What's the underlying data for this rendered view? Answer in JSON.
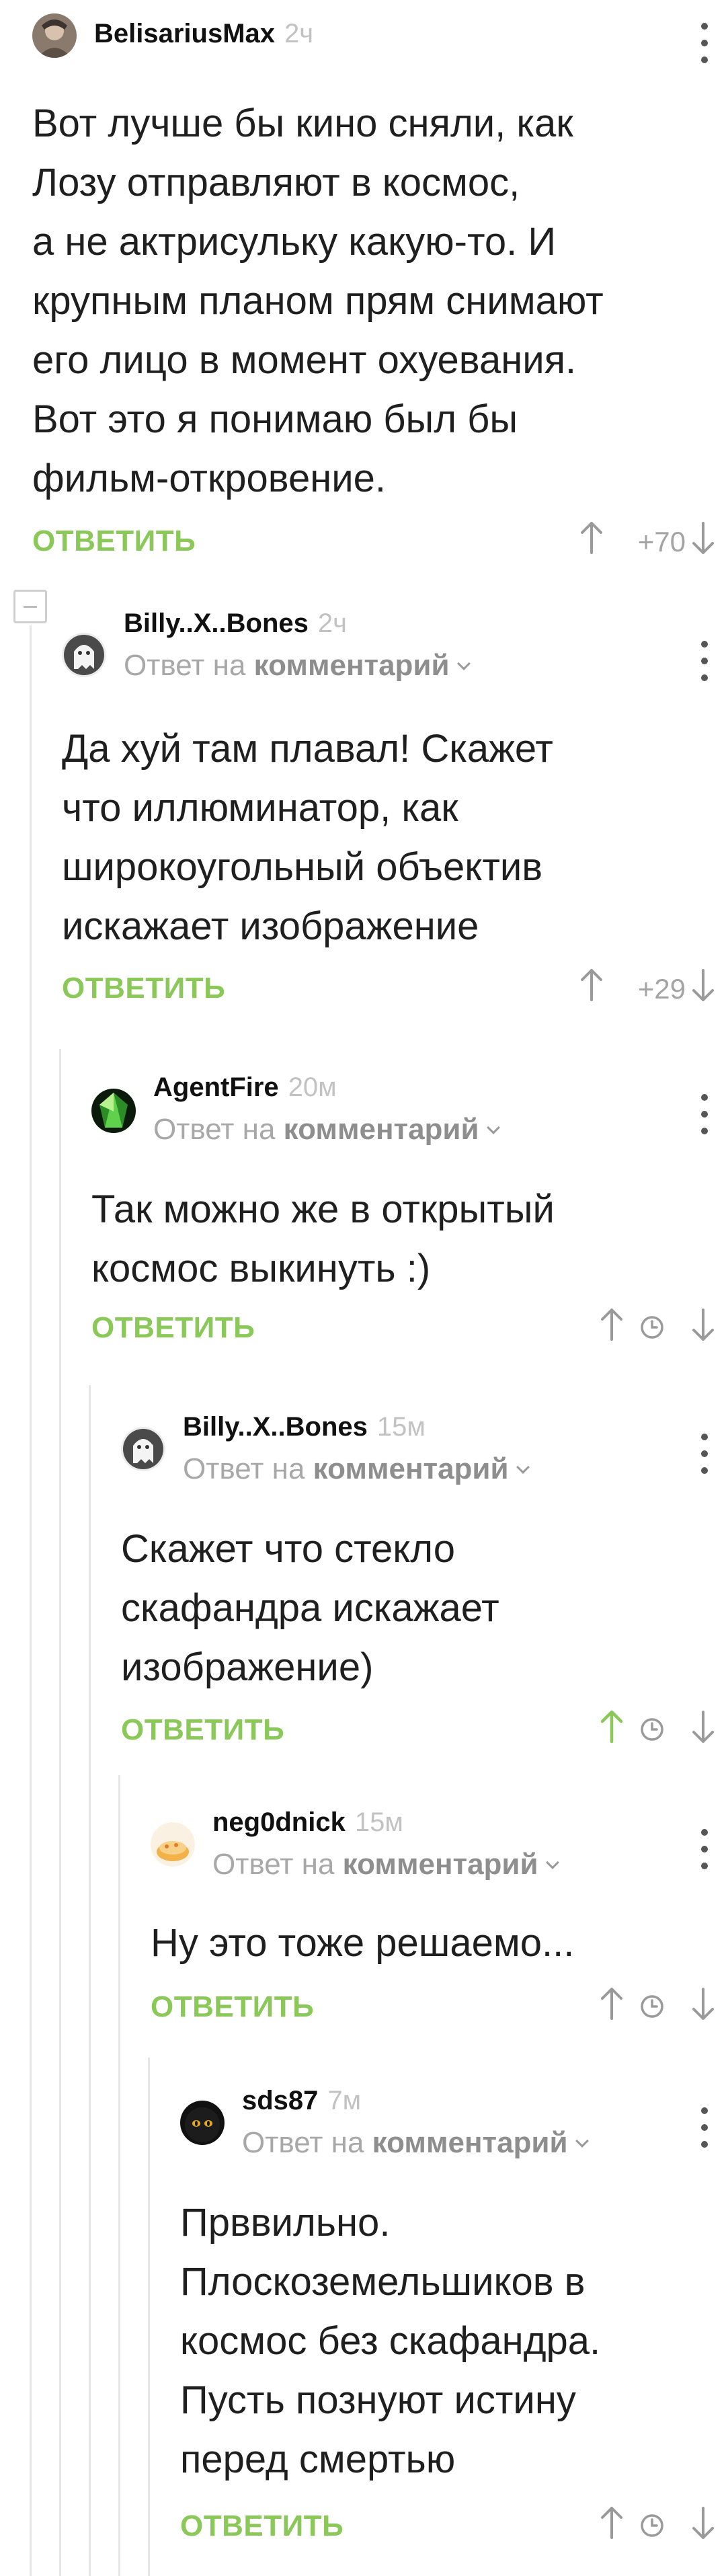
{
  "reply_label": "ОТВЕТИТЬ",
  "reply_to_prefix": "Ответ на",
  "reply_to_link": "комментарий",
  "comments": [
    {
      "author": "BelisariusMax",
      "time": "2ч",
      "text_lines": [
        "Вот лучше бы кино сняли, как",
        "Лозу отправляют в космос,",
        "а не актрисульку какую-то. И",
        "крупным планом прям снимают",
        "его лицо в момент охуевания.",
        "Вот это я понимаю был бы",
        "фильм-откровение."
      ],
      "score": "+70",
      "avatar_icon": "belisarius-avatar"
    },
    {
      "author": "Billy..X..Bones",
      "time": "2ч",
      "text_lines": [
        "Да хуй там плавал! Скажет",
        "что иллюминатор, как",
        "широкоугольный объектив",
        "искажает изображение"
      ],
      "score": "+29",
      "avatar_icon": "ghost-avatar"
    },
    {
      "author": "AgentFire",
      "time": "20м",
      "text_lines": [
        "Так можно же в открытый",
        "космос выкинуть :)"
      ],
      "score_hidden": true,
      "avatar_icon": "green-crystal-avatar"
    },
    {
      "author": "Billy..X..Bones",
      "time": "15м",
      "text_lines": [
        "Скажет что стекло",
        "скафандра искажает",
        "изображение)"
      ],
      "score_hidden": true,
      "upvoted": true,
      "avatar_icon": "ghost-avatar"
    },
    {
      "author": "neg0dnick",
      "time": "15м",
      "text_lines": [
        "Ну это тоже решаемо..."
      ],
      "score_hidden": true,
      "avatar_icon": "food-avatar"
    },
    {
      "author": "sds87",
      "time": "7м",
      "text_lines": [
        "Прввильно.",
        "Плоскоземельшиков в",
        "космос без скафандра.",
        "Пусть познуют истину",
        "перед смертью"
      ],
      "score_hidden": true,
      "avatar_icon": "black-cat-avatar"
    }
  ],
  "colors": {
    "reply": "#8ac858",
    "upvoted": "#8ac858",
    "meta": "#a8a8a8"
  }
}
